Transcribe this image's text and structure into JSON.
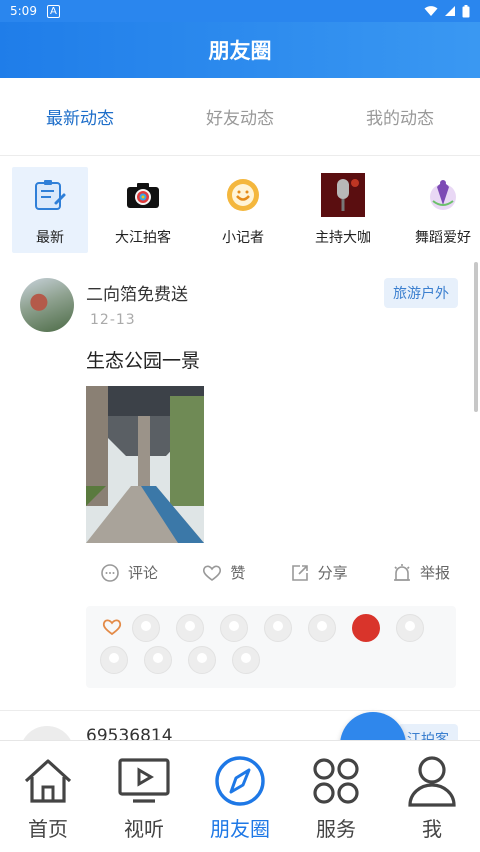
{
  "status_bar": {
    "time": "5:09",
    "notification_letter": "A"
  },
  "app_bar": {
    "title": "朋友圈"
  },
  "tabs": [
    {
      "label": "最新动态",
      "active": true
    },
    {
      "label": "好友动态",
      "active": false
    },
    {
      "label": "我的动态",
      "active": false
    }
  ],
  "categories": [
    {
      "label": "最新",
      "icon": "note-icon",
      "active": true
    },
    {
      "label": "大江拍客",
      "icon": "camera-icon",
      "active": false
    },
    {
      "label": "小记者",
      "icon": "smiley-badge-icon",
      "active": false
    },
    {
      "label": "主持大咖",
      "icon": "microphone-icon",
      "active": false
    },
    {
      "label": "舞蹈爱好",
      "icon": "dancer-icon",
      "active": false
    }
  ],
  "post": {
    "author": "二向箔免费送",
    "date": "12-13",
    "tag": "旅游户外",
    "text": "生态公园一景",
    "actions": {
      "comment": "评论",
      "like": "赞",
      "share": "分享",
      "report": "举报"
    }
  },
  "next_post": {
    "author": "69536814",
    "tag": "江拍客"
  },
  "bottom_nav": [
    {
      "label": "首页",
      "icon": "home-icon",
      "active": false
    },
    {
      "label": "视听",
      "icon": "tv-play-icon",
      "active": false
    },
    {
      "label": "朋友圈",
      "icon": "compass-icon",
      "active": true
    },
    {
      "label": "服务",
      "icon": "grid-icon",
      "active": false
    },
    {
      "label": "我",
      "icon": "person-icon",
      "active": false
    }
  ],
  "colors": {
    "primary": "#2a86ee",
    "active_text": "#1e78e6",
    "tag_bg": "#e7f0fb"
  }
}
